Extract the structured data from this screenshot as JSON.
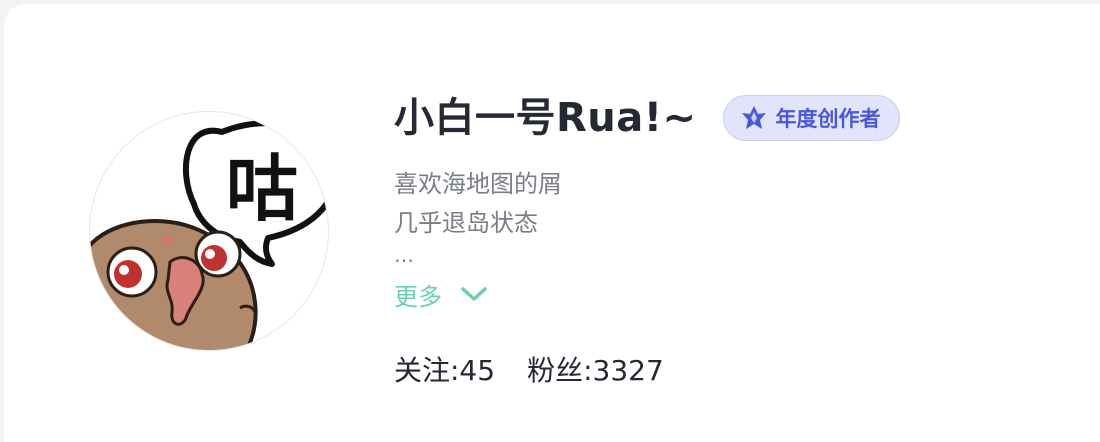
{
  "profile": {
    "nickname": "小白一号Rua!~",
    "badge": {
      "label": "年度创作者",
      "icon": "diamond-crest-icon",
      "color": "#4a57d6",
      "background": "#e2e4fc"
    },
    "avatar": {
      "speech_text": "咕"
    },
    "bio_lines": [
      "喜欢海地图的屑",
      "几乎退岛状态",
      "…"
    ],
    "more_label": "更多",
    "more_icon": "chevron-down-icon",
    "accent_color": "#6ccfb0"
  },
  "stats": {
    "following": "关注:45",
    "followers": "粉丝:3327"
  }
}
